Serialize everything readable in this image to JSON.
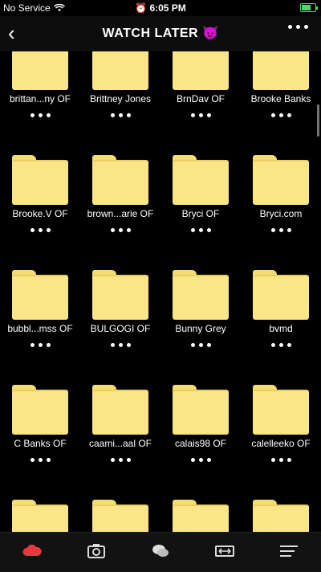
{
  "status": {
    "carrier": "No Service",
    "time": "6:05 PM"
  },
  "header": {
    "title": "WATCH LATER 😈"
  },
  "folders": [
    {
      "name": "brittan...ny OF"
    },
    {
      "name": "Brittney Jones"
    },
    {
      "name": "BrnDav OF"
    },
    {
      "name": "Brooke Banks"
    },
    {
      "name": "Brooke.V OF"
    },
    {
      "name": "brown...arie OF"
    },
    {
      "name": "Bryci OF"
    },
    {
      "name": "Bryci.com"
    },
    {
      "name": "bubbl...mss OF"
    },
    {
      "name": "BULGOGI OF"
    },
    {
      "name": "Bunny Grey"
    },
    {
      "name": "bvmd"
    },
    {
      "name": "C Banks OF"
    },
    {
      "name": "caami...aal OF"
    },
    {
      "name": "calais98 OF"
    },
    {
      "name": "calelleeko OF"
    }
  ],
  "tabbar": {
    "icons": [
      "cloud-icon",
      "camera-icon",
      "chat-icon",
      "transfer-icon",
      "menu-icon"
    ],
    "active_color": "#e8383d"
  }
}
